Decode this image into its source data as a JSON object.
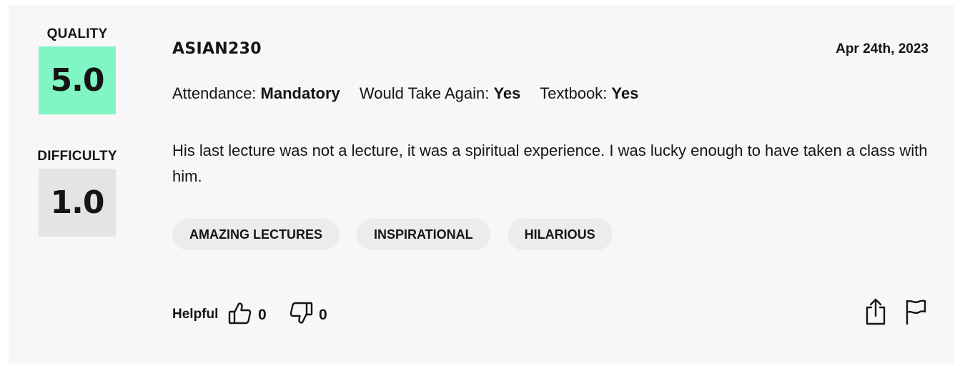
{
  "ratings": {
    "quality_label": "QUALITY",
    "quality_value": "5.0",
    "quality_color": "#7ff6c3",
    "difficulty_label": "DIFFICULTY",
    "difficulty_value": "1.0",
    "difficulty_color": "#e4e4e4"
  },
  "review": {
    "author": "ASIAN230",
    "date": "Apr 24th, 2023",
    "meta": [
      {
        "label": "Attendance: ",
        "value": "Mandatory"
      },
      {
        "label": "Would Take Again: ",
        "value": "Yes"
      },
      {
        "label": "Textbook: ",
        "value": "Yes"
      }
    ],
    "comment": "His last lecture was not a lecture, it was a spiritual experience. I was lucky enough to have taken a class with him.",
    "tags": [
      "AMAZING LECTURES",
      "INSPIRATIONAL",
      "HILARIOUS"
    ]
  },
  "footer": {
    "helpful_label": "Helpful",
    "thumbs_up_count": "0",
    "thumbs_down_count": "0",
    "icons": [
      "thumbs-up-icon",
      "thumbs-down-icon",
      "share-icon",
      "flag-icon"
    ]
  }
}
